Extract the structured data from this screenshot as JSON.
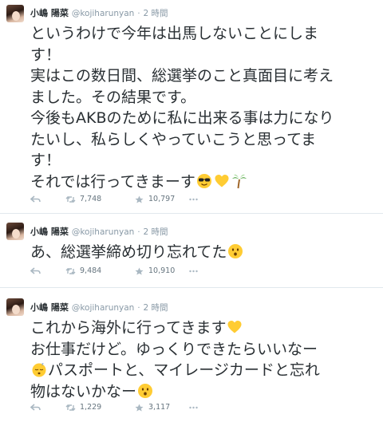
{
  "tweets": [
    {
      "name": "小嶋 陽菜",
      "handle": "@kojiharunyan",
      "separator": "·",
      "time": "2 時間",
      "lines": [
        "というわけで今年は出馬しないことにしま",
        "す！",
        "実はこの数日間、総選挙のこと真面目に考え",
        "ました。その結果です。",
        "今後もAKBのために私に出来る事は力になり",
        "たいし、私らしくやっていこうと思ってま",
        "す！",
        "それでは行ってきまーす"
      ],
      "emoji": [
        "sunglasses-face-emoji",
        "yellow-heart-emoji",
        "palm-tree-emoji"
      ],
      "retweets": "7,748",
      "favorites": "10,797"
    },
    {
      "name": "小嶋 陽菜",
      "handle": "@kojiharunyan",
      "separator": "·",
      "time": "2 時間",
      "lines": [
        "あ、総選挙締め切り忘れてた"
      ],
      "emoji": [
        "hushed-face-emoji"
      ],
      "retweets": "9,484",
      "favorites": "10,910"
    },
    {
      "name": "小嶋 陽菜",
      "handle": "@kojiharunyan",
      "separator": "·",
      "time": "2 時間",
      "lines": [
        "これから海外に行ってきます",
        "お仕事だけど。ゆっくりできたらいいなー",
        "パスポートと、マイレージカードと忘れ",
        "物はないかなー"
      ],
      "emoji": [
        "yellow-heart-emoji",
        "sleeping-face-emoji",
        "hushed-face-emoji"
      ],
      "retweets": "1,229",
      "favorites": "3,117"
    }
  ],
  "colors": {
    "text": "#292f33",
    "muted": "#8899a6",
    "divider": "#e1e8ed",
    "emoji_yellow": "#ffcc33",
    "palm_green": "#3f9b2f"
  }
}
